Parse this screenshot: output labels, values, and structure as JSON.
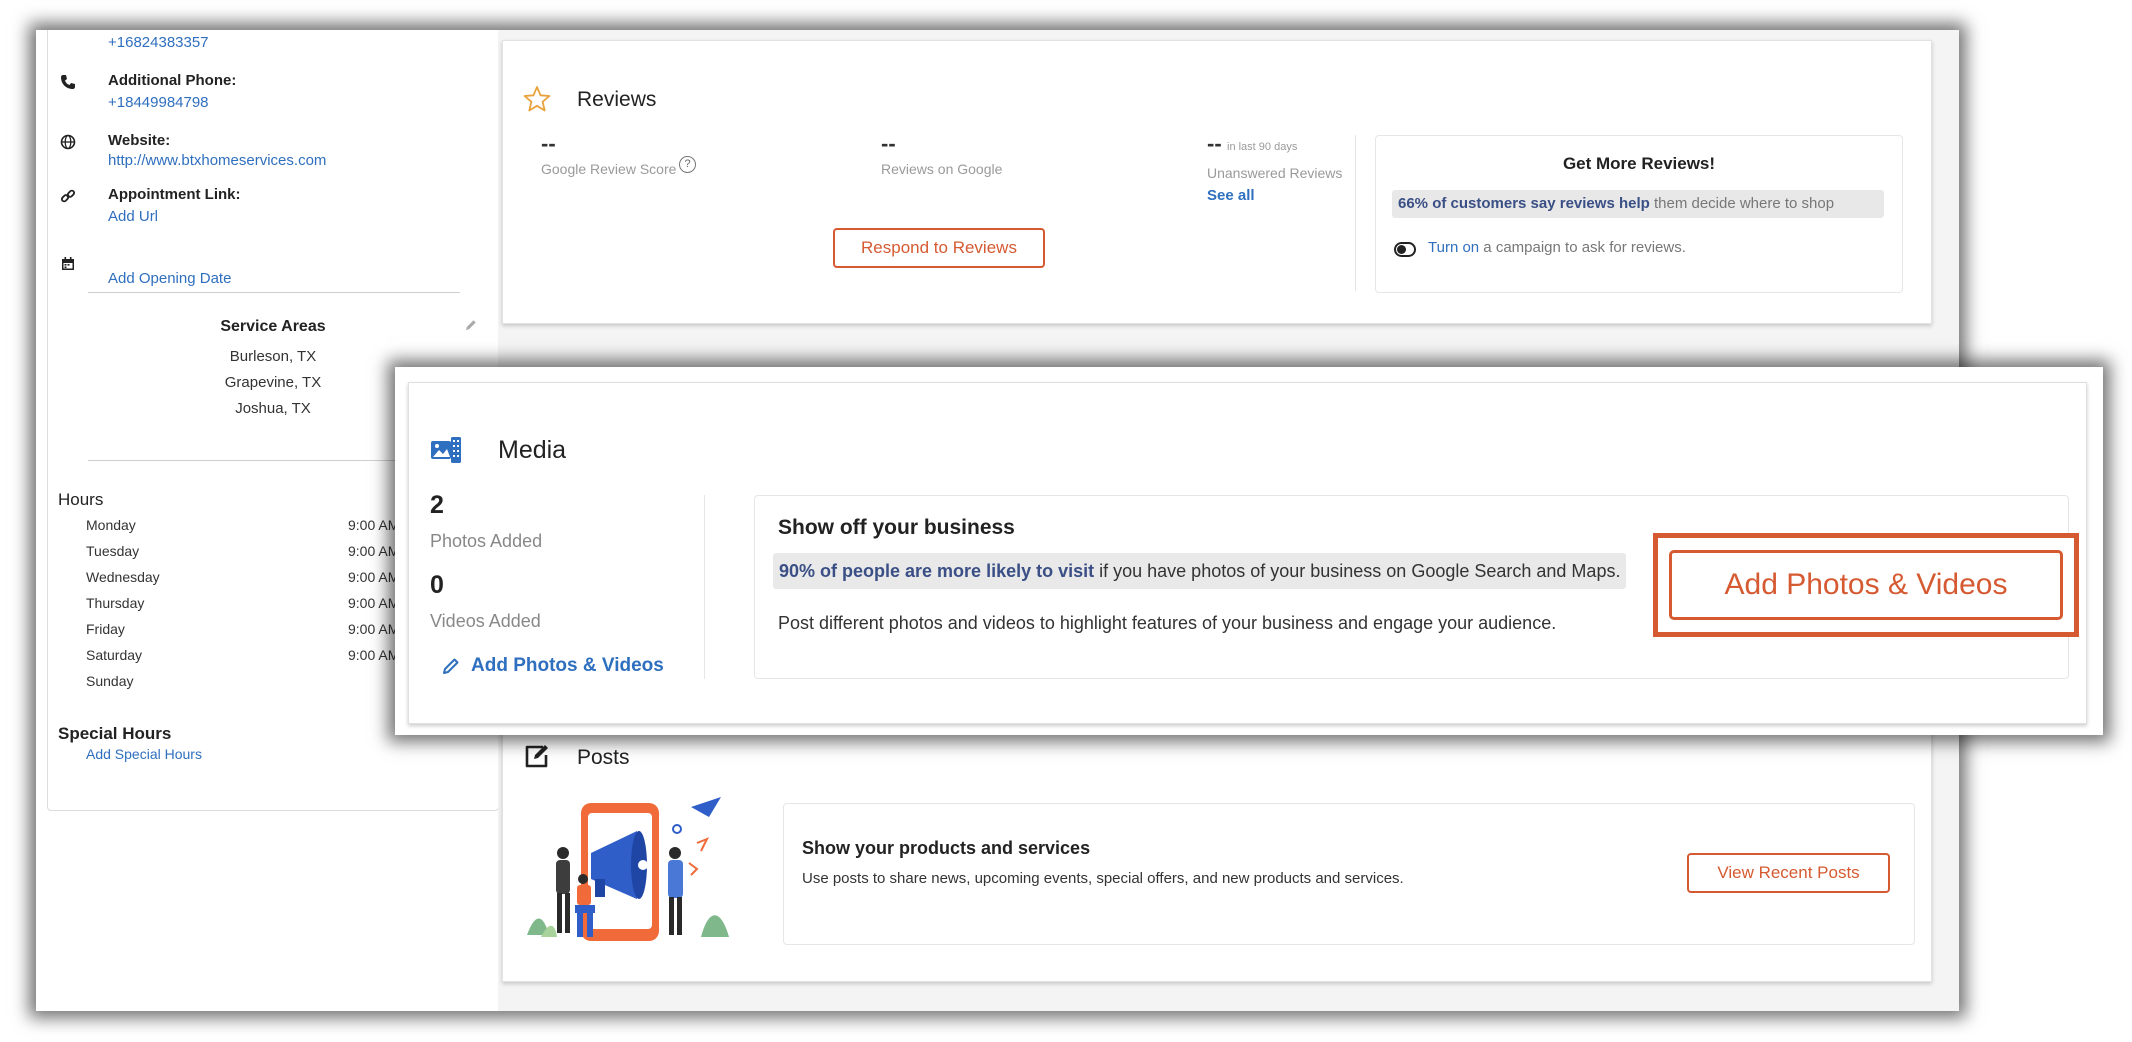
{
  "contact": {
    "primary_phone": "+16824383357",
    "additional_phone_label": "Additional Phone:",
    "additional_phone": "+18449984798",
    "website_label": "Website:",
    "website": "http://www.btxhomeservices.com",
    "appointment_label": "Appointment Link:",
    "appointment_add": "Add Url",
    "opening_date_add": "Add Opening Date"
  },
  "service_areas": {
    "title": "Service Areas",
    "items": [
      "Burleson, TX",
      "Grapevine, TX",
      "Joshua, TX"
    ]
  },
  "hours": {
    "title": "Hours",
    "rows": [
      {
        "day": "Monday",
        "time": "9:00 AM"
      },
      {
        "day": "Tuesday",
        "time": "9:00 AM"
      },
      {
        "day": "Wednesday",
        "time": "9:00 AM"
      },
      {
        "day": "Thursday",
        "time": "9:00 AM"
      },
      {
        "day": "Friday",
        "time": "9:00 AM"
      },
      {
        "day": "Saturday",
        "time": "9:00 AM"
      },
      {
        "day": "Sunday",
        "time": ""
      }
    ],
    "special_title": "Special Hours",
    "special_add": "Add Special Hours"
  },
  "reviews": {
    "title": "Reviews",
    "score_value": "--",
    "score_label": "Google Review Score",
    "count_value": "--",
    "count_label": "Reviews on Google",
    "unanswered_value": "--",
    "unanswered_period": "in last 90 days",
    "unanswered_label": "Unanswered Reviews",
    "see_all": "See all",
    "respond_button": "Respond to Reviews",
    "help_glyph": "?",
    "get_more": {
      "title": "Get More Reviews!",
      "highlight_bold": "66% of customers say reviews help",
      "highlight_rest": " them decide where to shop",
      "turn_on": "Turn on",
      "campaign_text": " a campaign to ask for reviews."
    }
  },
  "media": {
    "title": "Media",
    "photos_count": "2",
    "photos_label": "Photos Added",
    "videos_count": "0",
    "videos_label": "Videos Added",
    "add_link": "Add Photos & Videos",
    "heading": "Show off your business",
    "highlight_bold": "90% of people are more likely to visit",
    "highlight_rest": " if you have photos of your business on Google Search and Maps.",
    "description": "Post different photos and videos to highlight features of your business and engage your audience.",
    "add_button": "Add Photos & Videos"
  },
  "posts": {
    "title": "Posts",
    "heading": "Show your products and services",
    "description": "Use posts to share news, upcoming events, special offers, and new products and services.",
    "view_button": "View Recent Posts"
  },
  "colors": {
    "accent": "#d65a31",
    "link": "#2f6fbf",
    "highlight_text": "#3a4f85"
  }
}
